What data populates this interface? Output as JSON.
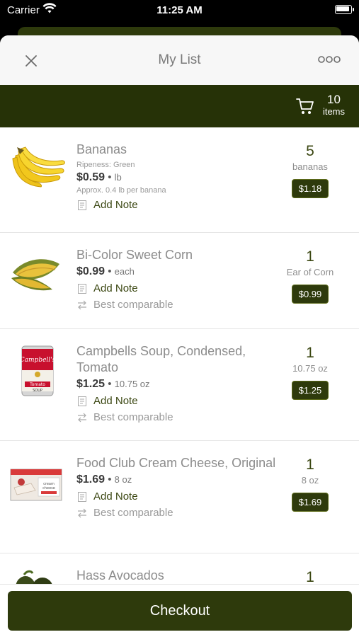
{
  "status_bar": {
    "carrier": "Carrier",
    "time": "11:25 AM"
  },
  "header": {
    "title": "My List"
  },
  "cart": {
    "count": "10",
    "label": "items"
  },
  "items": [
    {
      "name": "Bananas",
      "ripeness": "Ripeness: Green",
      "price": "$0.59",
      "unit": "lb",
      "approx": "Approx. 0.4 lb per banana",
      "note_label": "Add Note",
      "qty": "5",
      "qty_unit": "bananas",
      "total": "$1.18"
    },
    {
      "name": "Bi-Color Sweet Corn",
      "price": "$0.99",
      "unit": "each",
      "note_label": "Add Note",
      "comparable_label": "Best comparable",
      "qty": "1",
      "qty_unit": "Ear of Corn",
      "total": "$0.99"
    },
    {
      "name": "Campbells Soup, Condensed, Tomato",
      "price": "$1.25",
      "unit": "10.75 oz",
      "note_label": "Add Note",
      "comparable_label": "Best comparable",
      "qty": "1",
      "qty_unit": "10.75 oz",
      "total": "$1.25"
    },
    {
      "name": "Food Club Cream Cheese, Original",
      "price": "$1.69",
      "unit": "8 oz",
      "note_label": "Add Note",
      "comparable_label": "Best comparable",
      "qty": "1",
      "qty_unit": "8 oz",
      "total": "$1.69"
    },
    {
      "name": "Hass Avocados",
      "qty": "1"
    }
  ],
  "checkout_label": "Checkout",
  "colors": {
    "brand_dark": "#263207",
    "button": "#2e3a0c",
    "accent_text": "#3b4712"
  }
}
